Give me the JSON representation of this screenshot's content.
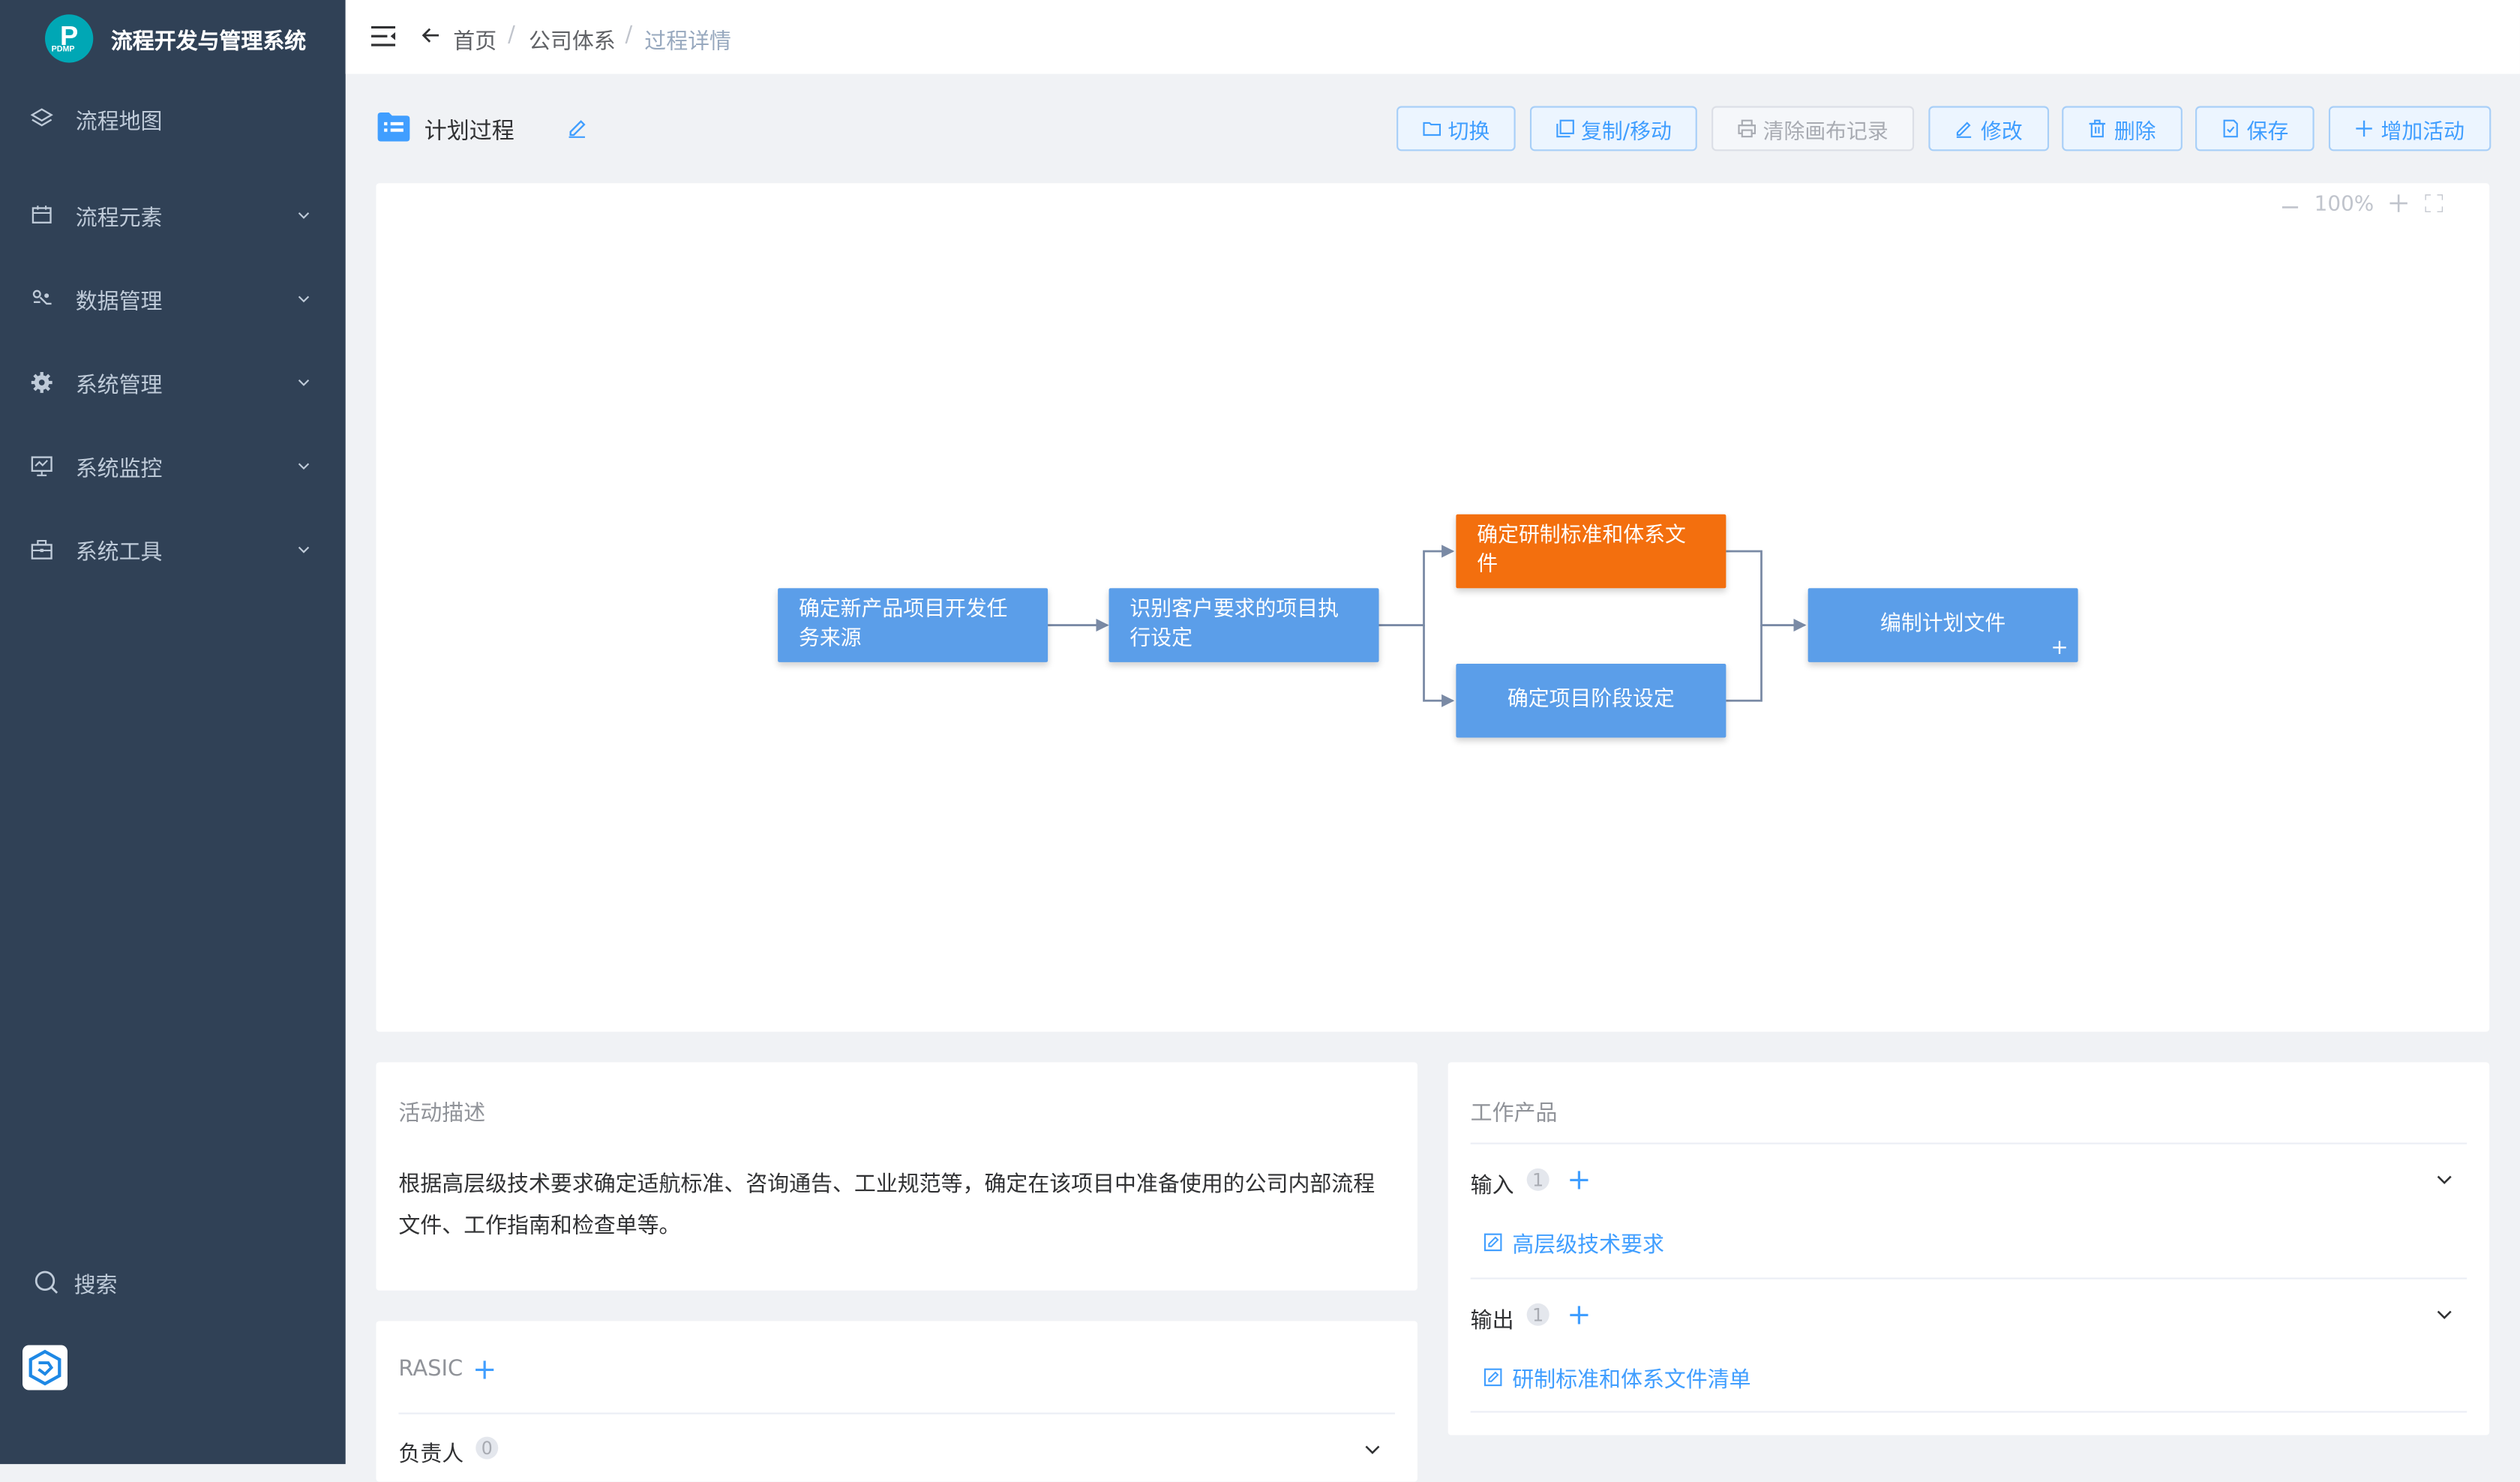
{
  "app": {
    "title": "流程开发与管理系统",
    "logo_text": "P",
    "logo_sub": "PDMP"
  },
  "sidebar": {
    "items": [
      {
        "label": "流程地图",
        "icon": "layers-icon",
        "expandable": false
      },
      {
        "label": "流程元素",
        "icon": "calendar-icon",
        "expandable": true
      },
      {
        "label": "数据管理",
        "icon": "data-icon",
        "expandable": true
      },
      {
        "label": "系统管理",
        "icon": "gear-icon",
        "expandable": true
      },
      {
        "label": "系统监控",
        "icon": "monitor-icon",
        "expandable": true
      },
      {
        "label": "系统工具",
        "icon": "toolbox-icon",
        "expandable": true
      }
    ],
    "search_label": "搜索"
  },
  "navbar": {
    "breadcrumb": [
      "首页",
      "公司体系",
      "过程详情"
    ]
  },
  "page": {
    "title": "计划过程",
    "toolbar": {
      "switch": "切换",
      "copy_move": "复制/移动",
      "clear_canvas": "清除画布记录",
      "edit": "修改",
      "delete": "删除",
      "save": "保存",
      "add_activity": "增加活动"
    }
  },
  "canvas": {
    "zoom_level": "100%",
    "nodes": [
      {
        "id": "n1",
        "label": "确定新产品项目开发任务来源",
        "color": "#5b9ee9"
      },
      {
        "id": "n2",
        "label": "识别客户要求的项目执行设定",
        "color": "#5b9ee9"
      },
      {
        "id": "n3",
        "label": "确定研制标准和体系文件",
        "color": "#f36f0e",
        "selected": true
      },
      {
        "id": "n4",
        "label": "确定项目阶段设定",
        "color": "#5b9ee9"
      },
      {
        "id": "n5",
        "label": "编制计划文件",
        "color": "#5b9ee9",
        "plus": "+"
      }
    ],
    "edges": [
      [
        "n1",
        "n2"
      ],
      [
        "n2",
        "n3"
      ],
      [
        "n2",
        "n4"
      ],
      [
        "n3",
        "n5"
      ],
      [
        "n4",
        "n5"
      ]
    ]
  },
  "activity": {
    "title": "活动描述",
    "description": "根据高层级技术要求确定适航标准、咨询通告、工业规范等，确定在该项目中准备使用的公司内部流程文件、工作指南和检查单等。"
  },
  "rasic": {
    "title": "RASIC",
    "owner_label": "负责人",
    "owner_count": "0"
  },
  "work_products": {
    "title": "工作产品",
    "input_label": "输入",
    "input_count": "1",
    "input_item": "高层级技术要求",
    "output_label": "输出",
    "output_count": "1",
    "output_item": "研制标准和体系文件清单"
  },
  "colors": {
    "sidebar_bg": "#304156",
    "accent": "#409eff",
    "node_blue": "#5b9ee9",
    "node_orange": "#f36f0e"
  }
}
